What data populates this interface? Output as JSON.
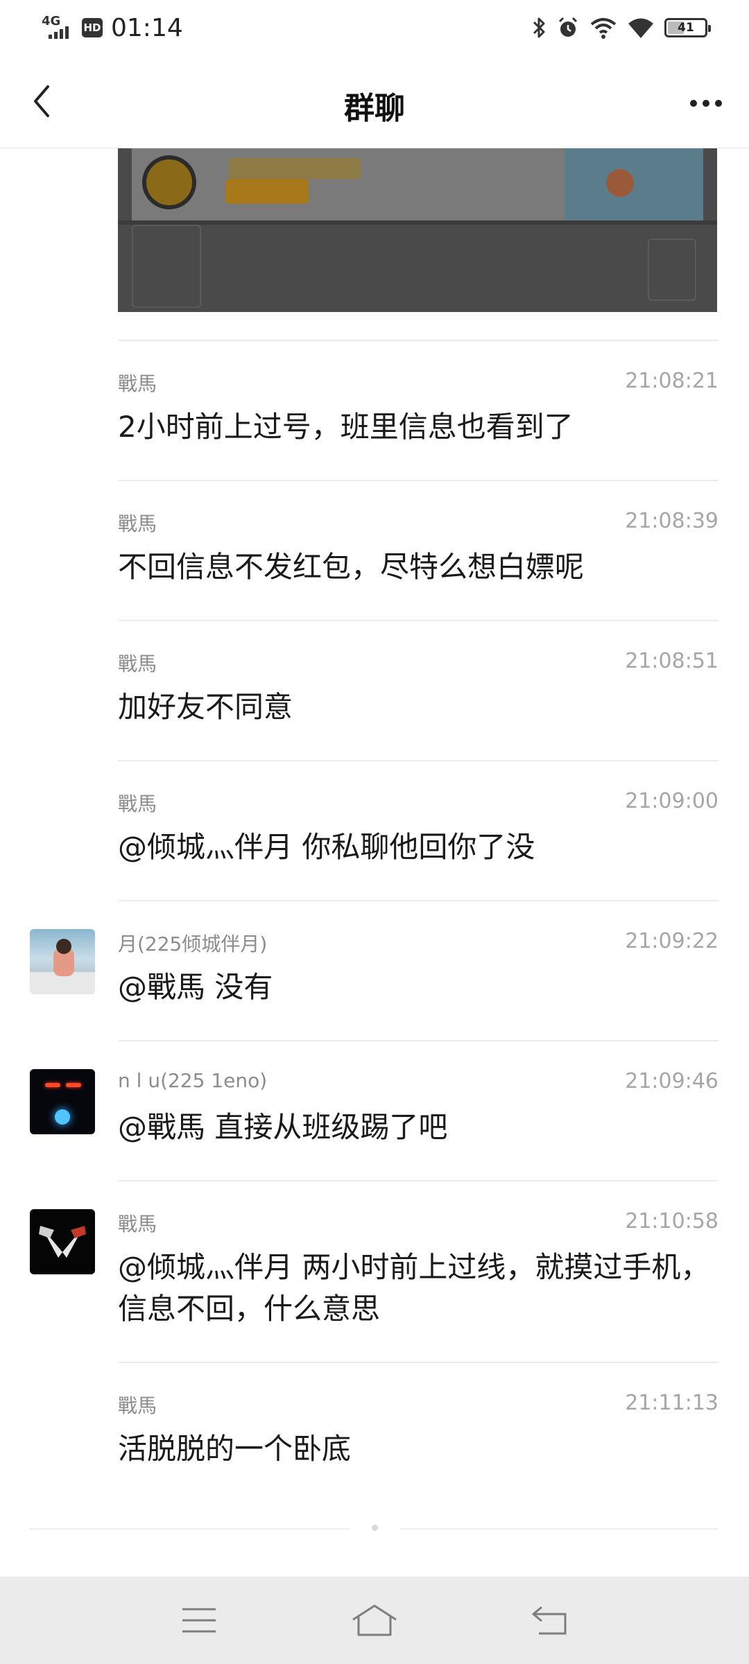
{
  "status_bar": {
    "network": "4G",
    "hd": "HD",
    "time": "01:14",
    "battery": "41",
    "battery_level": 0.41
  },
  "header": {
    "title": "群聊",
    "back_icon": "chevron-left-icon",
    "more_icon": "more-dots-icon"
  },
  "shared_image": {
    "description_icon": "image-thumbnail"
  },
  "messages": [
    {
      "sender": "戰馬",
      "time": "21:08:21",
      "text": "2小时前上过号，班里信息也看到了"
    },
    {
      "sender": "戰馬",
      "time": "21:08:39",
      "text": "不回信息不发红包，尽特么想白嫖呢"
    },
    {
      "sender": "戰馬",
      "time": "21:08:51",
      "text": "加好友不同意"
    },
    {
      "sender": "戰馬",
      "time": "21:09:00",
      "text": "@倾城灬伴月 你私聊他回你了没"
    },
    {
      "sender": "月(225倾城伴月)",
      "time": "21:09:22",
      "text": "@戰馬 没有"
    },
    {
      "sender": "n l u(225      1eno)",
      "time": "21:09:46",
      "text": "@戰馬 直接从班级踢了吧"
    },
    {
      "sender": "戰馬",
      "time": "21:10:58",
      "text": "@倾城灬伴月 两小时前上过线，就摸过手机，信息不回，什么意思"
    },
    {
      "sender": "戰馬",
      "time": "21:11:13",
      "text": "活脱脱的一个卧底"
    }
  ],
  "nav_bar": {
    "menu_icon": "menu-icon",
    "home_icon": "home-icon",
    "back_icon": "back-arrow-icon"
  }
}
